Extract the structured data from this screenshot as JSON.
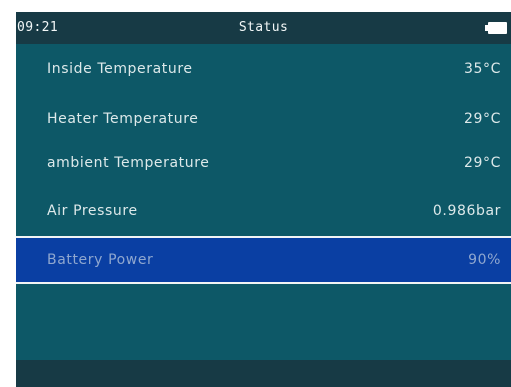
{
  "status_bar": {
    "time": "09:21",
    "title": "Status",
    "battery_icon": "battery-icon"
  },
  "rows": [
    {
      "label": "Inside Temperature",
      "value": "35°C"
    },
    {
      "label": "Heater Temperature",
      "value": "29°C"
    },
    {
      "label": "ambient Temperature",
      "value": "29°C"
    },
    {
      "label": "Air Pressure",
      "value": "0.986bar"
    },
    {
      "label": "Battery Power",
      "value": "90%"
    }
  ],
  "selected_row": 4,
  "colors": {
    "background": "#0d5867",
    "status_bar": "#173a45",
    "selection": "#0a3fa3",
    "text": "#dde9ea"
  }
}
